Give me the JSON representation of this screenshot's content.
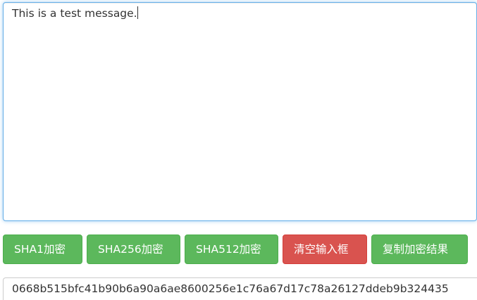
{
  "input": {
    "value": "This is a test message."
  },
  "buttons": {
    "sha1": "SHA1加密",
    "sha256": "SHA256加密",
    "sha512": "SHA512加密",
    "clear": "清空输入框",
    "copy": "复制加密结果"
  },
  "result": {
    "value": "0668b515bfc41b90b6a90a6ae8600256e1c76a67d17c78a26127ddeb9b324435"
  },
  "colors": {
    "success": "#5cb85c",
    "danger": "#d9534f",
    "focus_border": "#66afe9",
    "text": "#333333"
  }
}
